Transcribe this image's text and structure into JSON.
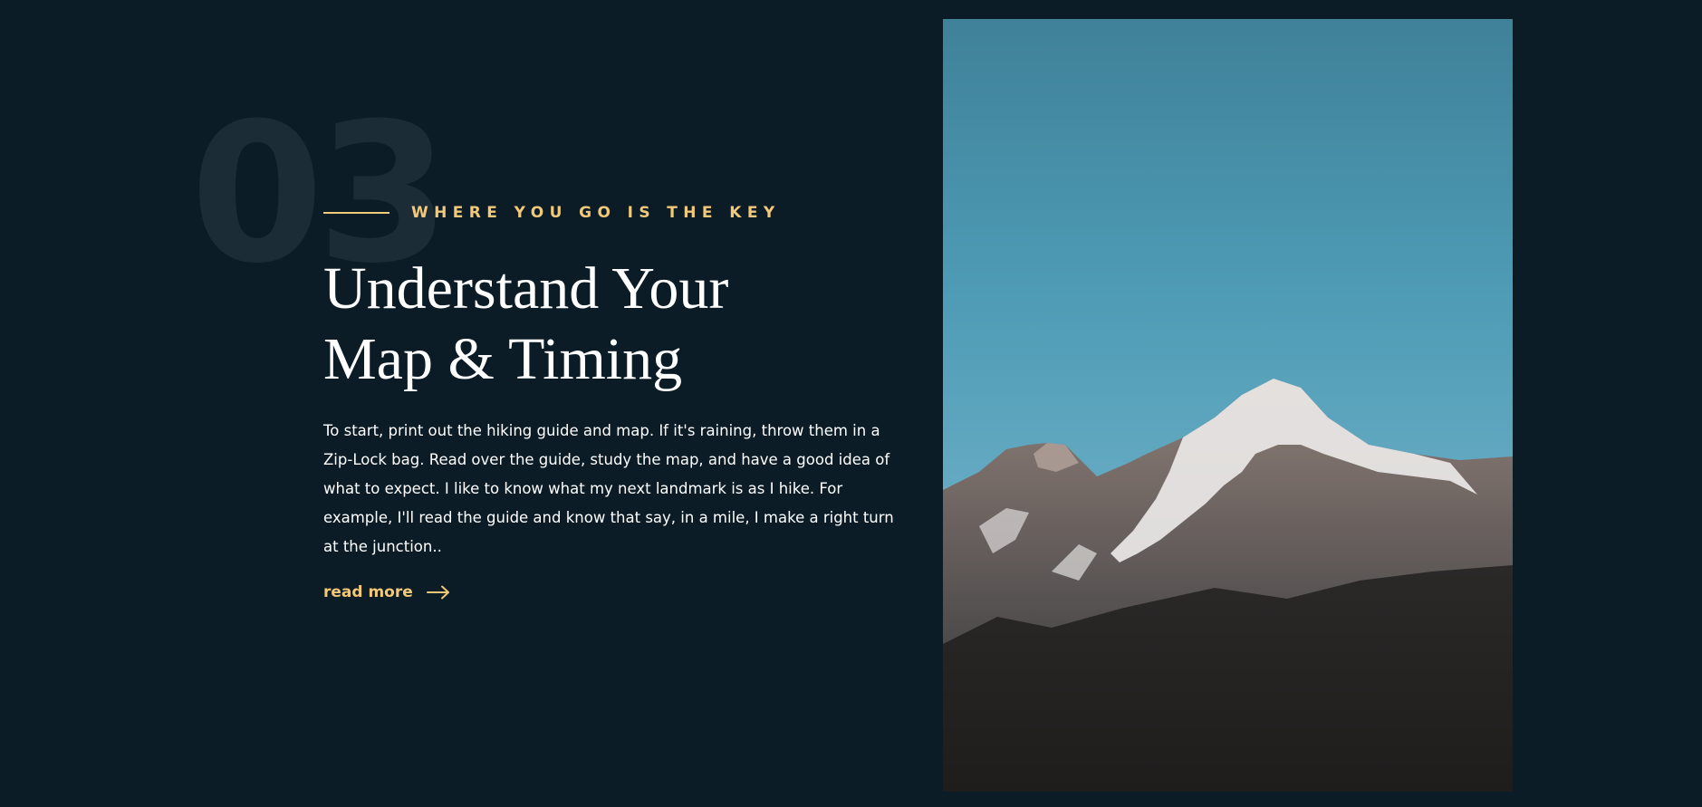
{
  "section": {
    "number": "03",
    "eyebrow": "WHERE YOU GO IS THE KEY",
    "title_lines": [
      "Understand Your",
      "Map & Timing"
    ],
    "body": "To start, print out the hiking guide and map. If it's raining, throw them in a Zip-Lock bag. Read over the guide, study the map, and have a good idea of what to expect. I like to know what my next landmark is as I hike. For example, I'll read the guide and know that say, in a mile, I make a right turn at the junction..",
    "read_more_label": "read more",
    "read_more_icon": "arrow-right-icon",
    "image_subject": "mountain-photo"
  },
  "colors": {
    "background": "#0b1c26",
    "accent": "#f2c879",
    "number_watermark": "#1c2c36",
    "text": "#ffffff"
  }
}
